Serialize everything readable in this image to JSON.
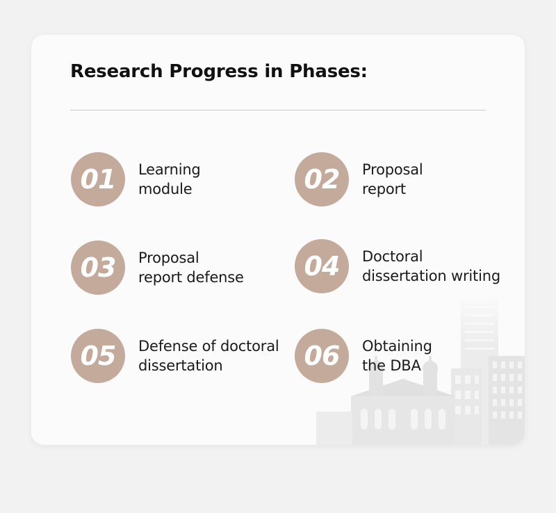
{
  "header": {
    "title": "Research Progress in Phases:"
  },
  "phases": [
    {
      "number": "01",
      "lines": [
        "Learning",
        "module"
      ]
    },
    {
      "number": "02",
      "lines": [
        "Proposal",
        "report"
      ]
    },
    {
      "number": "03",
      "lines": [
        "Proposal",
        "report defense"
      ]
    },
    {
      "number": "04",
      "lines": [
        "Doctoral",
        "dissertation writing"
      ]
    },
    {
      "number": "05",
      "lines": [
        "Defense of doctoral",
        "dissertation"
      ]
    },
    {
      "number": "06",
      "lines": [
        "Obtaining",
        "the DBA"
      ]
    }
  ],
  "colors": {
    "badge": "#c4aa9b",
    "card": "#fbfbfb",
    "background": "#f2f2f2",
    "title": "#111111"
  }
}
